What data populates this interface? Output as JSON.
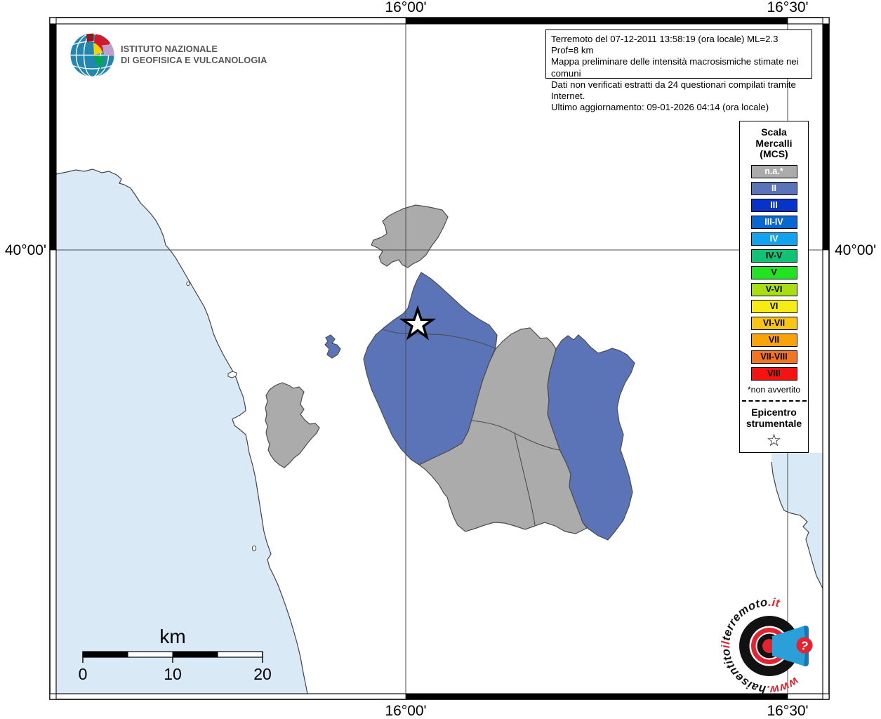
{
  "colors": {
    "sea": "#D9E9F6",
    "land": "#FFFFFF",
    "muni_gray": "#ABABAB",
    "muni_blue": "#5B74B8",
    "boundary": "#4D4D4D",
    "coast": "#444444",
    "gridline": "#4D4D4D",
    "frame_black": "#000000",
    "logo_red": "#E8212E",
    "logo_blue": "#2B9FD8",
    "logo_blue_dark": "#1578B4",
    "ingv_globe": "#2286AE"
  },
  "axis": {
    "top_left": "16°00'",
    "top_right": "16°30'",
    "bottom_left": "16°00'",
    "bottom_right": "16°30'",
    "left": "40°00'",
    "right": "40°00'"
  },
  "ingv": {
    "line1": "ISTITUTO NAZIONALE",
    "line2": "DI GEOFISICA E VULCANOLOGIA"
  },
  "info_box": {
    "line1": "Terremoto del 07-12-2011 13:58:19 (ora locale) ML=2.3 Prof=8 km",
    "line2": "Mappa preliminare delle intensità macrosismiche stimate nei comuni",
    "line3": "Dati non verificati estratti da 24 questionari compilati tramite Internet.",
    "line4": "Ultimo aggiornamento: 09-01-2026 04:14 (ora locale)"
  },
  "legend": {
    "title_lines": [
      "Scala",
      "Mercalli",
      "(MCS)"
    ],
    "items": [
      {
        "label": "n.a.*",
        "color": "#ABABAB",
        "text_color": "#FFFFFF"
      },
      {
        "label": "II",
        "color": "#5B74B8",
        "text_color": "#FFFFFF"
      },
      {
        "label": "III",
        "color": "#0633C8",
        "text_color": "#FFFFFF"
      },
      {
        "label": "III-IV",
        "color": "#0967D2",
        "text_color": "#FFFFFF"
      },
      {
        "label": "IV",
        "color": "#12A3F0",
        "text_color": "#FFFFFF"
      },
      {
        "label": "IV-V",
        "color": "#10C273",
        "text_color": "#000000"
      },
      {
        "label": "V",
        "color": "#20E420",
        "text_color": "#000000"
      },
      {
        "label": "V-VI",
        "color": "#A8DE12",
        "text_color": "#000000"
      },
      {
        "label": "VI",
        "color": "#F8ED13",
        "text_color": "#000000"
      },
      {
        "label": "VI-VII",
        "color": "#F9C413",
        "text_color": "#000000"
      },
      {
        "label": "VII",
        "color": "#F9A309",
        "text_color": "#000000"
      },
      {
        "label": "VII-VIII",
        "color": "#F5721E",
        "text_color": "#000000"
      },
      {
        "label": "VIII",
        "color": "#F51210",
        "text_color": "#000000"
      }
    ],
    "footnote": "*non avvertito",
    "epicenter_line1": "Epicentro",
    "epicenter_line2": "strumentale",
    "star_symbol": "☆"
  },
  "scale_bar": {
    "unit": "km",
    "tick0": "0",
    "tick1": "10",
    "tick2": "20"
  },
  "watermark": {
    "seg_www": "www.",
    "seg_hai": "haisentito",
    "seg_il": "il",
    "seg_terremoto": "terremoto",
    "seg_it": ".it",
    "question_mark": "?"
  }
}
